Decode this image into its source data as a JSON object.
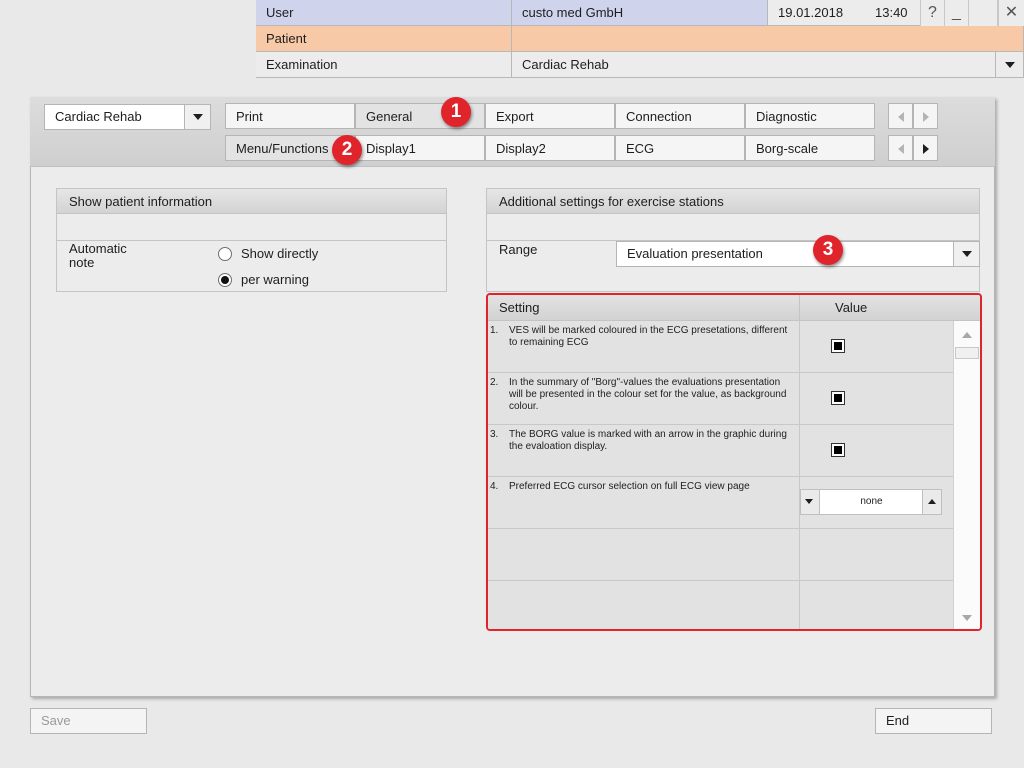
{
  "header": {
    "user_label": "User",
    "user_value": "custo med GmbH",
    "date": "19.01.2018",
    "time": "13:40",
    "help_glyph": "?",
    "minimize_glyph": "_",
    "close_glyph": "✕",
    "patient_label": "Patient",
    "patient_value": "",
    "examination_label": "Examination",
    "examination_value": "Cardiac Rehab",
    "colors": {
      "user_row": "#cfd3ec",
      "patient_row": "#f8c9a6"
    }
  },
  "toolbar": {
    "profile_select": "Cardiac Rehab",
    "tabs_row1": [
      "Print",
      "General",
      "Export",
      "Connection",
      "Diagnostic"
    ],
    "tabs_row2": [
      "Menu/Functions",
      "Display1",
      "Display2",
      "ECG",
      "Borg-scale"
    ],
    "active_tab_row1": "General",
    "active_tab_row2": "Menu/Functions"
  },
  "markers": [
    "1",
    "2",
    "3"
  ],
  "patient_info": {
    "title": "Show patient information",
    "auto_note_label": "Automatic\nnote",
    "options": [
      "Show directly",
      "per warning"
    ],
    "selected_option": "per warning"
  },
  "exercise": {
    "title": "Additional settings for exercise stations",
    "range_label": "Range",
    "range_value": "Evaluation presentation"
  },
  "settings_table": {
    "col_setting": "Setting",
    "col_value": "Value",
    "rows": [
      {
        "num": "1.",
        "text": "VES will be marked coloured in the ECG presetations, different to remaining ECG",
        "type": "checkbox",
        "checked": true
      },
      {
        "num": "2.",
        "text": "In the summary of \"Borg\"-values the evaluations presentation will be presented in the colour set for the value, as background colour.",
        "type": "checkbox",
        "checked": true
      },
      {
        "num": "3.",
        "text": "The BORG value is marked with an arrow in the graphic during the evaloation display.",
        "type": "checkbox",
        "checked": true
      },
      {
        "num": "4.",
        "text": "Preferred ECG cursor selection on full ECG view page",
        "type": "spinner",
        "value": "none"
      }
    ]
  },
  "footer": {
    "save_label": "Save",
    "end_label": "End"
  },
  "icons": {
    "dropdown": "chevron-down-icon",
    "nav_prev": "arrow-left-icon",
    "nav_next": "arrow-right-icon",
    "scroll_up": "scroll-up-icon",
    "scroll_down": "scroll-down-icon"
  },
  "accent_color": "#e0242c"
}
